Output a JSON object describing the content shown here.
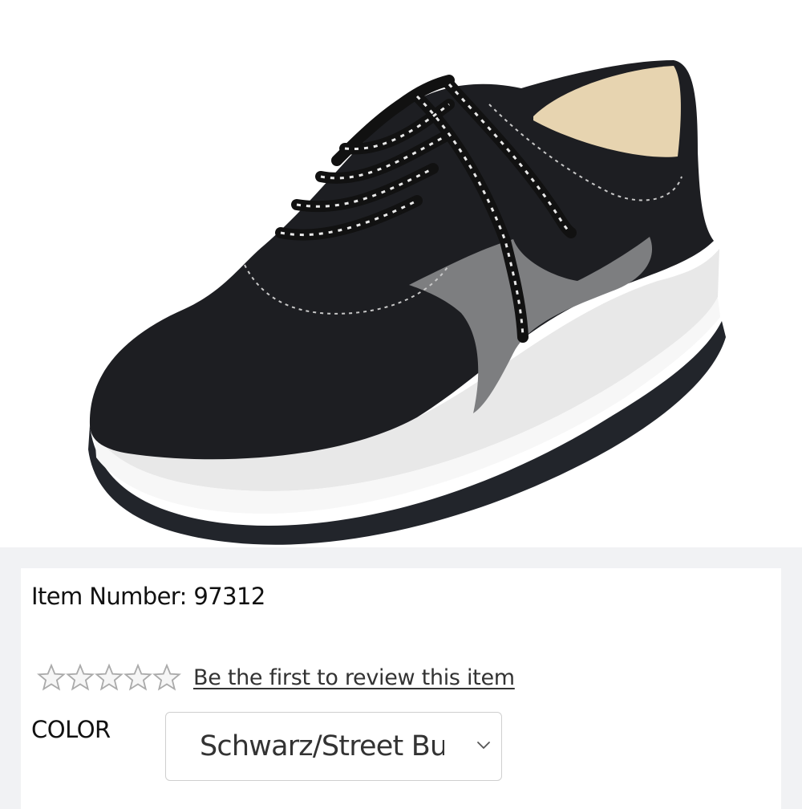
{
  "product": {
    "image_alt": "Black nubuck lace-up sneaker with grey side accent and white sole",
    "item_number_label": "Item Number:",
    "item_number": "97312"
  },
  "rating": {
    "stars_filled": 0,
    "stars_total": 5,
    "review_link": "Be the first to review this item"
  },
  "color": {
    "label": "COLOR",
    "selected": "Schwarz/Street Bu"
  },
  "icons": {
    "star": "star-outline-icon",
    "dropdown": "chevron-down-icon"
  },
  "colors": {
    "page_bg": "#f1f2f4",
    "shoe_upper": "#1d1e22",
    "shoe_accent": "#7d7e80",
    "sole": "#e6e6e6"
  }
}
